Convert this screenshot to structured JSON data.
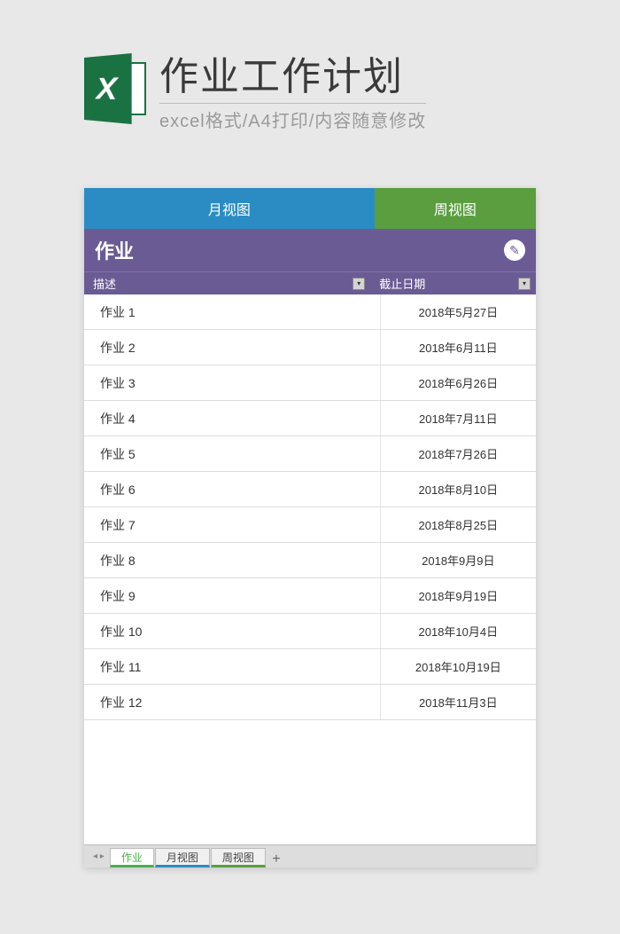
{
  "header": {
    "icon_letter": "X",
    "title": "作业工作计划",
    "subtitle": "excel格式/A4打印/内容随意修改"
  },
  "view_tabs": {
    "month": "月视图",
    "week": "周视图"
  },
  "section": {
    "title": "作业"
  },
  "columns": {
    "description": "描述",
    "due_date": "截止日期"
  },
  "rows": [
    {
      "desc": "作业 1",
      "date": "2018年5月27日"
    },
    {
      "desc": "作业 2",
      "date": "2018年6月11日"
    },
    {
      "desc": "作业 3",
      "date": "2018年6月26日"
    },
    {
      "desc": "作业 4",
      "date": "2018年7月11日"
    },
    {
      "desc": "作业 5",
      "date": "2018年7月26日"
    },
    {
      "desc": "作业 6",
      "date": "2018年8月10日"
    },
    {
      "desc": "作业 7",
      "date": "2018年8月25日"
    },
    {
      "desc": "作业 8",
      "date": "2018年9月9日"
    },
    {
      "desc": "作业 9",
      "date": "2018年9月19日"
    },
    {
      "desc": "作业 10",
      "date": "2018年10月4日"
    },
    {
      "desc": "作业 11",
      "date": "2018年10月19日"
    },
    {
      "desc": "作业 12",
      "date": "2018年11月3日"
    }
  ],
  "sheet_tabs": {
    "active": "作业",
    "month": "月视图",
    "week": "周视图",
    "add": "+"
  },
  "filter_glyph": "▾"
}
